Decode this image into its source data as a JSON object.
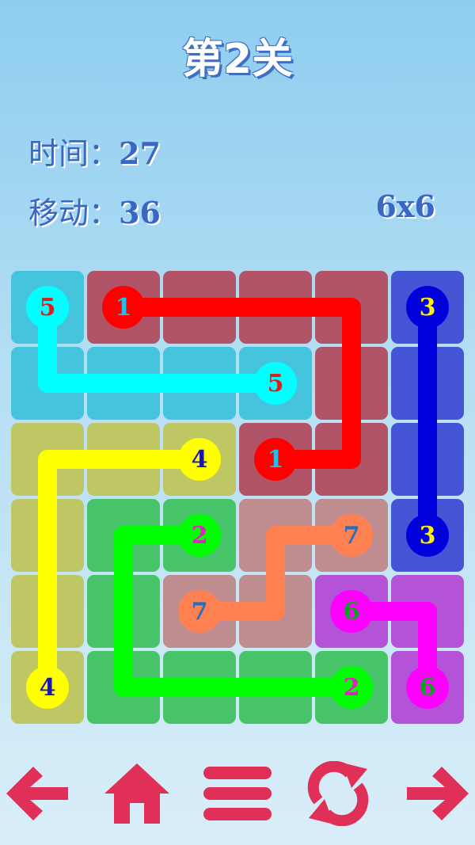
{
  "header": {
    "title": "第2关"
  },
  "stats": {
    "time_label": "时间：",
    "time_value": "27",
    "moves_label": "移动：",
    "moves_value": "36",
    "grid_size": "6x6"
  },
  "board": {
    "rows": 6,
    "cols": 6,
    "cells": [
      [
        "cyan",
        "red",
        "red",
        "red",
        "red",
        "blue"
      ],
      [
        "cyan",
        "cyan",
        "cyan",
        "cyan",
        "red",
        "blue"
      ],
      [
        "yellow",
        "yellow",
        "yellow",
        "red",
        "red",
        "blue"
      ],
      [
        "yellow",
        "green",
        "green",
        "salmon",
        "salmon",
        "blue"
      ],
      [
        "yellow",
        "green",
        "salmon",
        "salmon",
        "purple",
        "purple"
      ],
      [
        "yellow",
        "green",
        "green",
        "green",
        "green",
        "purple"
      ]
    ],
    "colors": {
      "cyan": {
        "cell": "#45c4dd",
        "line": "#00ffff",
        "num": "#e01c1c"
      },
      "red": {
        "cell": "#b15467",
        "line": "#ff0000",
        "num": "#20c0e8"
      },
      "blue": {
        "cell": "#4455d6",
        "line": "#0000dd",
        "num": "#ffee00"
      },
      "yellow": {
        "cell": "#bfc765",
        "line": "#ffff00",
        "num": "#1a1aa0"
      },
      "green": {
        "cell": "#48c46a",
        "line": "#00ff00",
        "num": "#e020c0"
      },
      "salmon": {
        "cell": "#bf8d8f",
        "line": "#ff8050",
        "num": "#2070c0"
      },
      "purple": {
        "cell": "#b452d8",
        "line": "#ff00ff",
        "num": "#10a020"
      }
    },
    "paths": [
      {
        "id": "5",
        "color": "cyan",
        "cells": [
          [
            0,
            0
          ],
          [
            1,
            0
          ],
          [
            1,
            1
          ],
          [
            1,
            2
          ],
          [
            1,
            3
          ]
        ]
      },
      {
        "id": "1",
        "color": "red",
        "cells": [
          [
            0,
            1
          ],
          [
            0,
            2
          ],
          [
            0,
            3
          ],
          [
            0,
            4
          ],
          [
            1,
            4
          ],
          [
            2,
            4
          ],
          [
            2,
            3
          ]
        ]
      },
      {
        "id": "3",
        "color": "blue",
        "cells": [
          [
            0,
            5
          ],
          [
            1,
            5
          ],
          [
            2,
            5
          ],
          [
            3,
            5
          ]
        ]
      },
      {
        "id": "4",
        "color": "yellow",
        "cells": [
          [
            2,
            2
          ],
          [
            2,
            1
          ],
          [
            2,
            0
          ],
          [
            3,
            0
          ],
          [
            4,
            0
          ],
          [
            5,
            0
          ]
        ]
      },
      {
        "id": "2",
        "color": "green",
        "cells": [
          [
            3,
            2
          ],
          [
            3,
            1
          ],
          [
            4,
            1
          ],
          [
            5,
            1
          ],
          [
            5,
            2
          ],
          [
            5,
            3
          ],
          [
            5,
            4
          ]
        ]
      },
      {
        "id": "7",
        "color": "salmon",
        "cells": [
          [
            3,
            4
          ],
          [
            3,
            3
          ],
          [
            4,
            3
          ],
          [
            4,
            2
          ]
        ]
      },
      {
        "id": "6",
        "color": "purple",
        "cells": [
          [
            4,
            4
          ],
          [
            4,
            5
          ],
          [
            5,
            5
          ]
        ]
      }
    ]
  },
  "toolbar": {
    "accent": "#e03058",
    "buttons": [
      {
        "name": "back-button",
        "icon": "arrow-left-icon"
      },
      {
        "name": "home-button",
        "icon": "home-icon"
      },
      {
        "name": "menu-button",
        "icon": "menu-icon"
      },
      {
        "name": "restart-button",
        "icon": "refresh-icon"
      },
      {
        "name": "next-button",
        "icon": "arrow-right-icon"
      }
    ]
  }
}
